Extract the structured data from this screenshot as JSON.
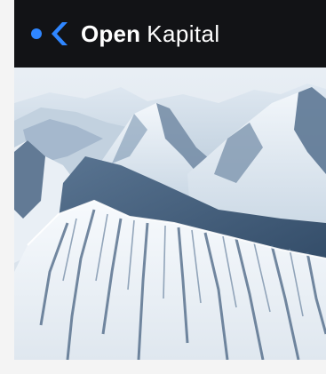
{
  "header": {
    "brand_bold": "Open",
    "brand_light": "Kapital",
    "logo_icon": "open-kapital-logo-icon",
    "background_color": "#121316",
    "accent_color": "#2f86ff"
  },
  "hero": {
    "image_subject": "snow-covered-mountain-peaks",
    "sky_color": "#dfe9f2",
    "snow_color": "#f3f7fb",
    "shadow_color": "#3f5a78"
  }
}
